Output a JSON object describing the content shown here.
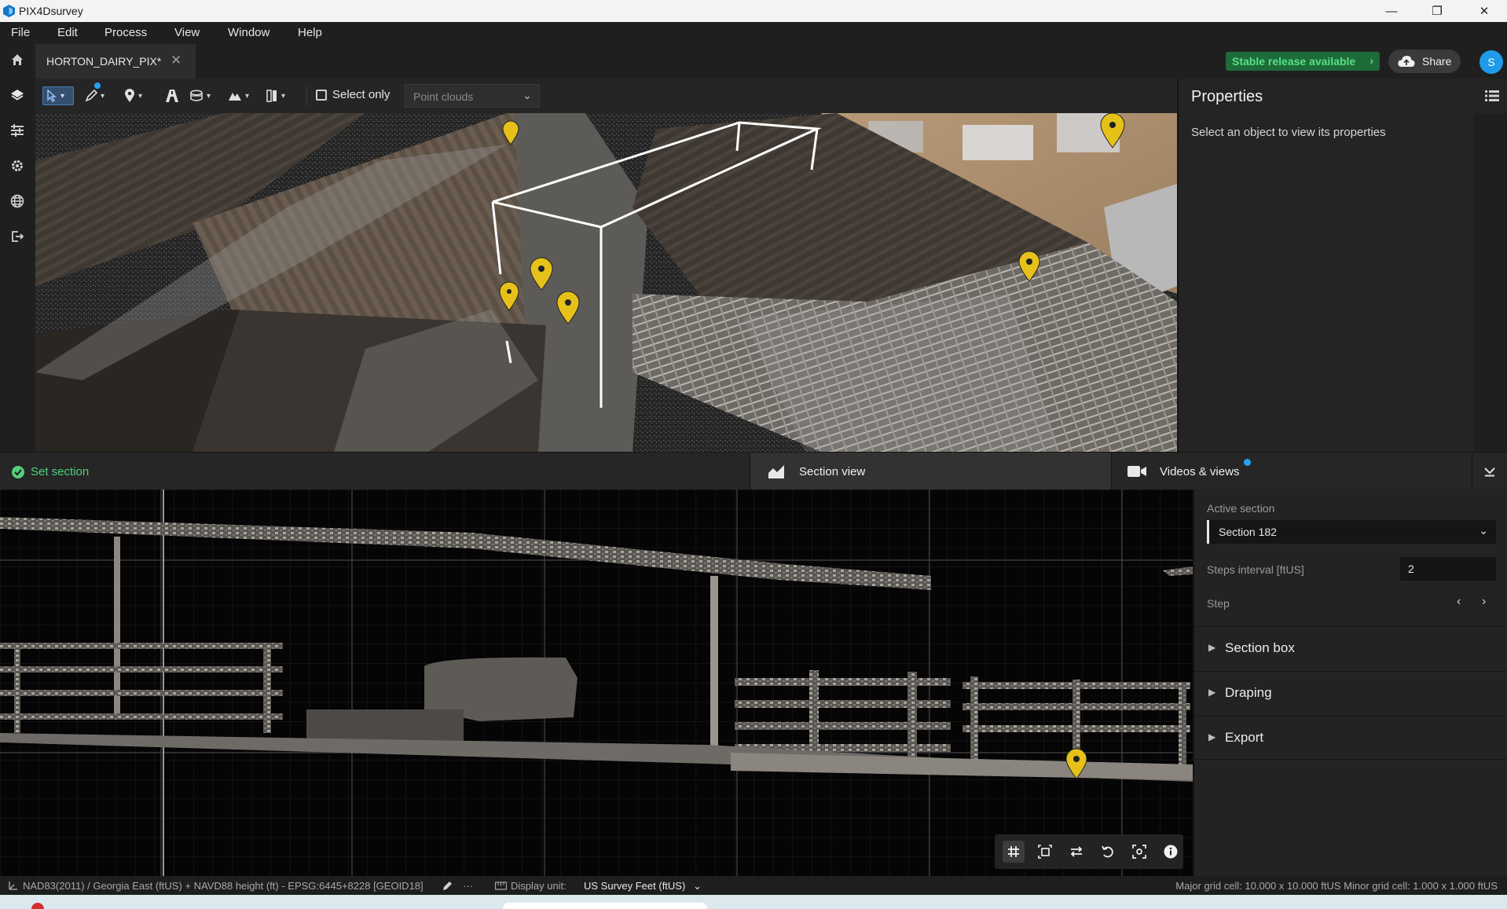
{
  "window": {
    "title": "PIX4Dsurvey",
    "controls": [
      "—",
      "❐",
      "✕"
    ]
  },
  "menu": [
    "File",
    "Edit",
    "Process",
    "View",
    "Window",
    "Help"
  ],
  "rail_icons": [
    "home-icon",
    "layers-icon",
    "sliders-icon",
    "gear-icon",
    "globe-icon",
    "export-icon"
  ],
  "tab": {
    "label": "HORTON_DAIRY_PIX*",
    "close": "✕"
  },
  "header": {
    "stable_release": "Stable release available",
    "share": "Share",
    "avatar_initial": "S"
  },
  "toolbar": {
    "select_only": "Select only",
    "point_clouds_placeholder": "Point clouds"
  },
  "properties": {
    "title": "Properties",
    "hint": "Select an object to view its properties"
  },
  "bottom_tabs": {
    "set_section": "Set section",
    "section_view": "Section view",
    "videos_views": "Videos & views"
  },
  "section_panel": {
    "active_section_label": "Active section",
    "active_section_value": "Section 182",
    "steps_interval_label": "Steps interval [ftUS]",
    "steps_interval_value": "2",
    "step_label": "Step",
    "accordions": [
      "Section box",
      "Draping",
      "Export"
    ]
  },
  "status": {
    "crs": "NAD83(2011) / Georgia East (ftUS) + NAVD88 height (ft) - EPSG:6445+8228 [GEOID18]",
    "more": "···",
    "display_unit_label": "Display unit:",
    "display_unit_value": "US Survey Feet (ftUS)",
    "grid_info": "Major grid cell: 10.000 x 10.000 ftUS  Minor grid cell: 1.000 x 1.000 ftUS"
  },
  "colors": {
    "accent_green": "#52d07a",
    "accent_blue": "#22a5f5",
    "marker_yellow": "#e6c11a"
  }
}
